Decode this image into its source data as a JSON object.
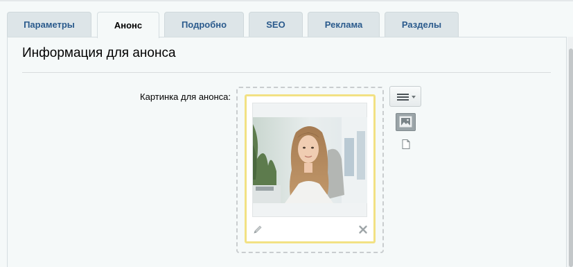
{
  "tabs": [
    {
      "label": "Параметры",
      "active": false
    },
    {
      "label": "Анонс",
      "active": true
    },
    {
      "label": "Подробно",
      "active": false
    },
    {
      "label": "SEO",
      "active": false
    },
    {
      "label": "Реклама",
      "active": false
    },
    {
      "label": "Разделы",
      "active": false
    }
  ],
  "section": {
    "title": "Информация для анонса"
  },
  "preview_image": {
    "label": "Картинка для анонса:"
  },
  "icons": {
    "menu": "hamburger-menu-icon",
    "dropdown": "chevron-down-icon",
    "image_view": "image-icon",
    "file_view": "file-icon",
    "edit": "pencil-icon",
    "delete": "close-icon"
  },
  "colors": {
    "tab_text": "#2a5a8c",
    "frame_border": "#f2e183",
    "panel_bg": "#f5f9f9"
  }
}
